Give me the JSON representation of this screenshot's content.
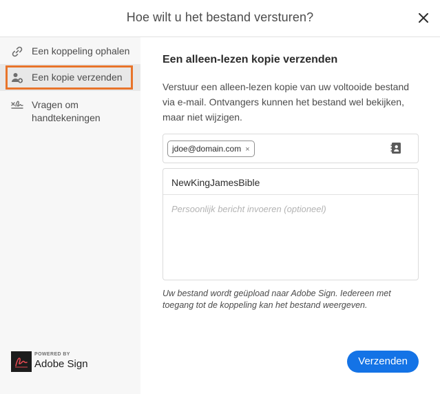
{
  "dialog": {
    "title": "Hoe wilt u het bestand versturen?"
  },
  "sidebar": {
    "items": [
      {
        "label": "Een koppeling ophalen",
        "icon": "link-icon"
      },
      {
        "label": "Een kopie verzenden",
        "icon": "add-person-icon",
        "selected": true
      },
      {
        "label": "Vragen om handtekeningen",
        "icon": "signature-icon"
      }
    ],
    "brand": {
      "powered_by": "POWERED BY",
      "name": "Adobe Sign"
    }
  },
  "main": {
    "heading": "Een alleen-lezen kopie verzenden",
    "description": "Verstuur een alleen-lezen kopie van uw voltooide bestand via e-mail. Ontvangers kunnen het bestand wel bekijken, maar niet wijzigen.",
    "recipient_chip": "jdoe@domain.com",
    "chip_remove": "×",
    "subject": "NewKingJamesBible",
    "message_placeholder": "Persoonlijk bericht invoeren (optioneel)",
    "footnote": "Uw bestand wordt geüpload naar Adobe Sign. Iedereen met toegang tot de koppeling kan het bestand weergeven.",
    "send_label": "Verzenden"
  },
  "colors": {
    "accent": "#1473e6",
    "selection_outline": "#e8742a",
    "sidebar_bg": "#f7f7f7"
  }
}
